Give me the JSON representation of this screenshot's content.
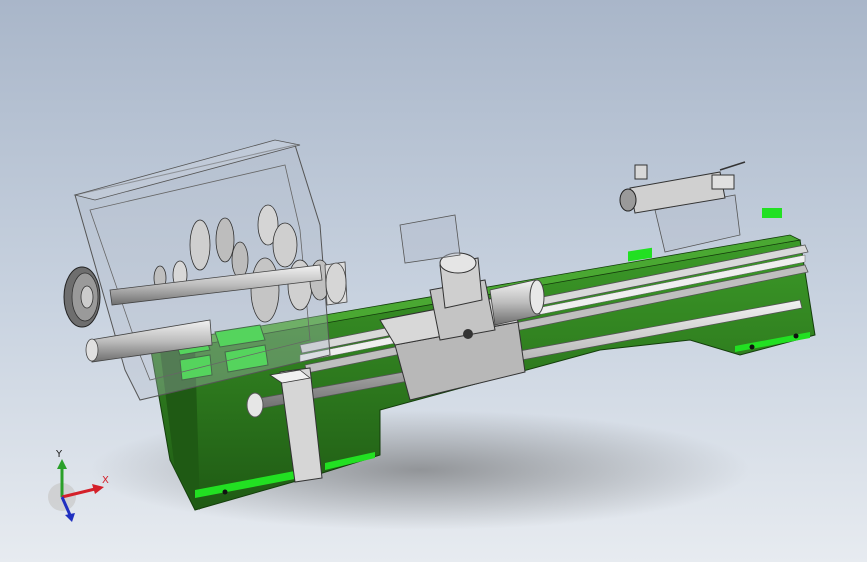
{
  "viewport": {
    "background_top": "#a9b6c9",
    "background_bottom": "#e7ebf0",
    "model": "lathe-assembly"
  },
  "colors": {
    "bed_green": "#2d7a1e",
    "bed_green_dark": "#1f5a14",
    "pad_green": "#22e022",
    "steel": "#c8c8c8",
    "steel_dark": "#8a8a8a",
    "housing_glass": "#b4bccb"
  },
  "triad": {
    "x_label": "X",
    "y_label": "Y",
    "x_color": "#d4202a",
    "y_color": "#2aa02a",
    "z_color": "#2030c0"
  }
}
